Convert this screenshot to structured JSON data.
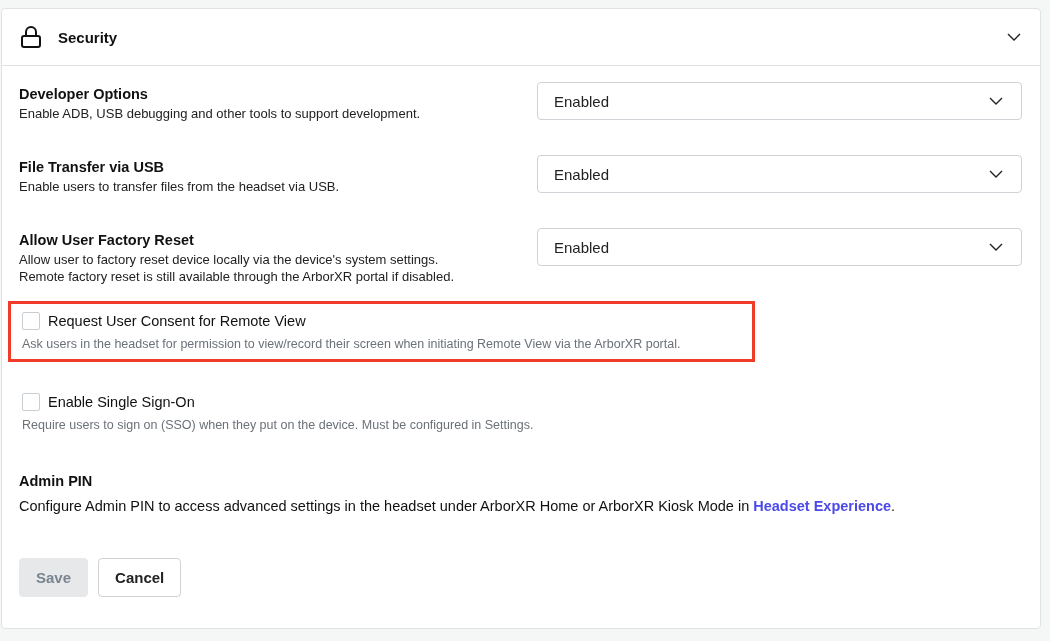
{
  "section": {
    "title": "Security",
    "expanded": true
  },
  "settings": [
    {
      "kind": "select",
      "title": "Developer Options",
      "description": [
        "Enable ADB, USB debugging and other tools to support development."
      ],
      "value": "Enabled"
    },
    {
      "kind": "select",
      "title": "File Transfer via USB",
      "description": [
        "Enable users to transfer files from the headset via USB."
      ],
      "value": "Enabled"
    },
    {
      "kind": "select",
      "title": "Allow User Factory Reset",
      "description": [
        "Allow user to factory reset device locally via the device's system settings.",
        "Remote factory reset is still available through the ArborXR portal if disabled."
      ],
      "value": "Enabled"
    },
    {
      "kind": "checkbox",
      "title": "Request User Consent for Remote View",
      "description": [
        "Ask users in the headset for permission to view/record their screen when initiating Remote View via the ArborXR portal."
      ],
      "checked": false,
      "highlighted": true
    },
    {
      "kind": "checkbox",
      "title": "Enable Single Sign-On",
      "description": [
        "Require users to sign on (SSO) when they put on the device. Must be configured in Settings."
      ],
      "checked": false,
      "highlighted": false
    },
    {
      "kind": "info",
      "title": "Admin PIN",
      "description": [
        "Configure Admin PIN to access advanced settings in the headset under ArborXR Home or ArborXR Kiosk Mode in"
      ],
      "link": "Headset Experience",
      "suffix": "."
    }
  ],
  "buttons": [
    {
      "label": "Save",
      "disabled": true
    },
    {
      "label": "Cancel",
      "disabled": false
    }
  ]
}
